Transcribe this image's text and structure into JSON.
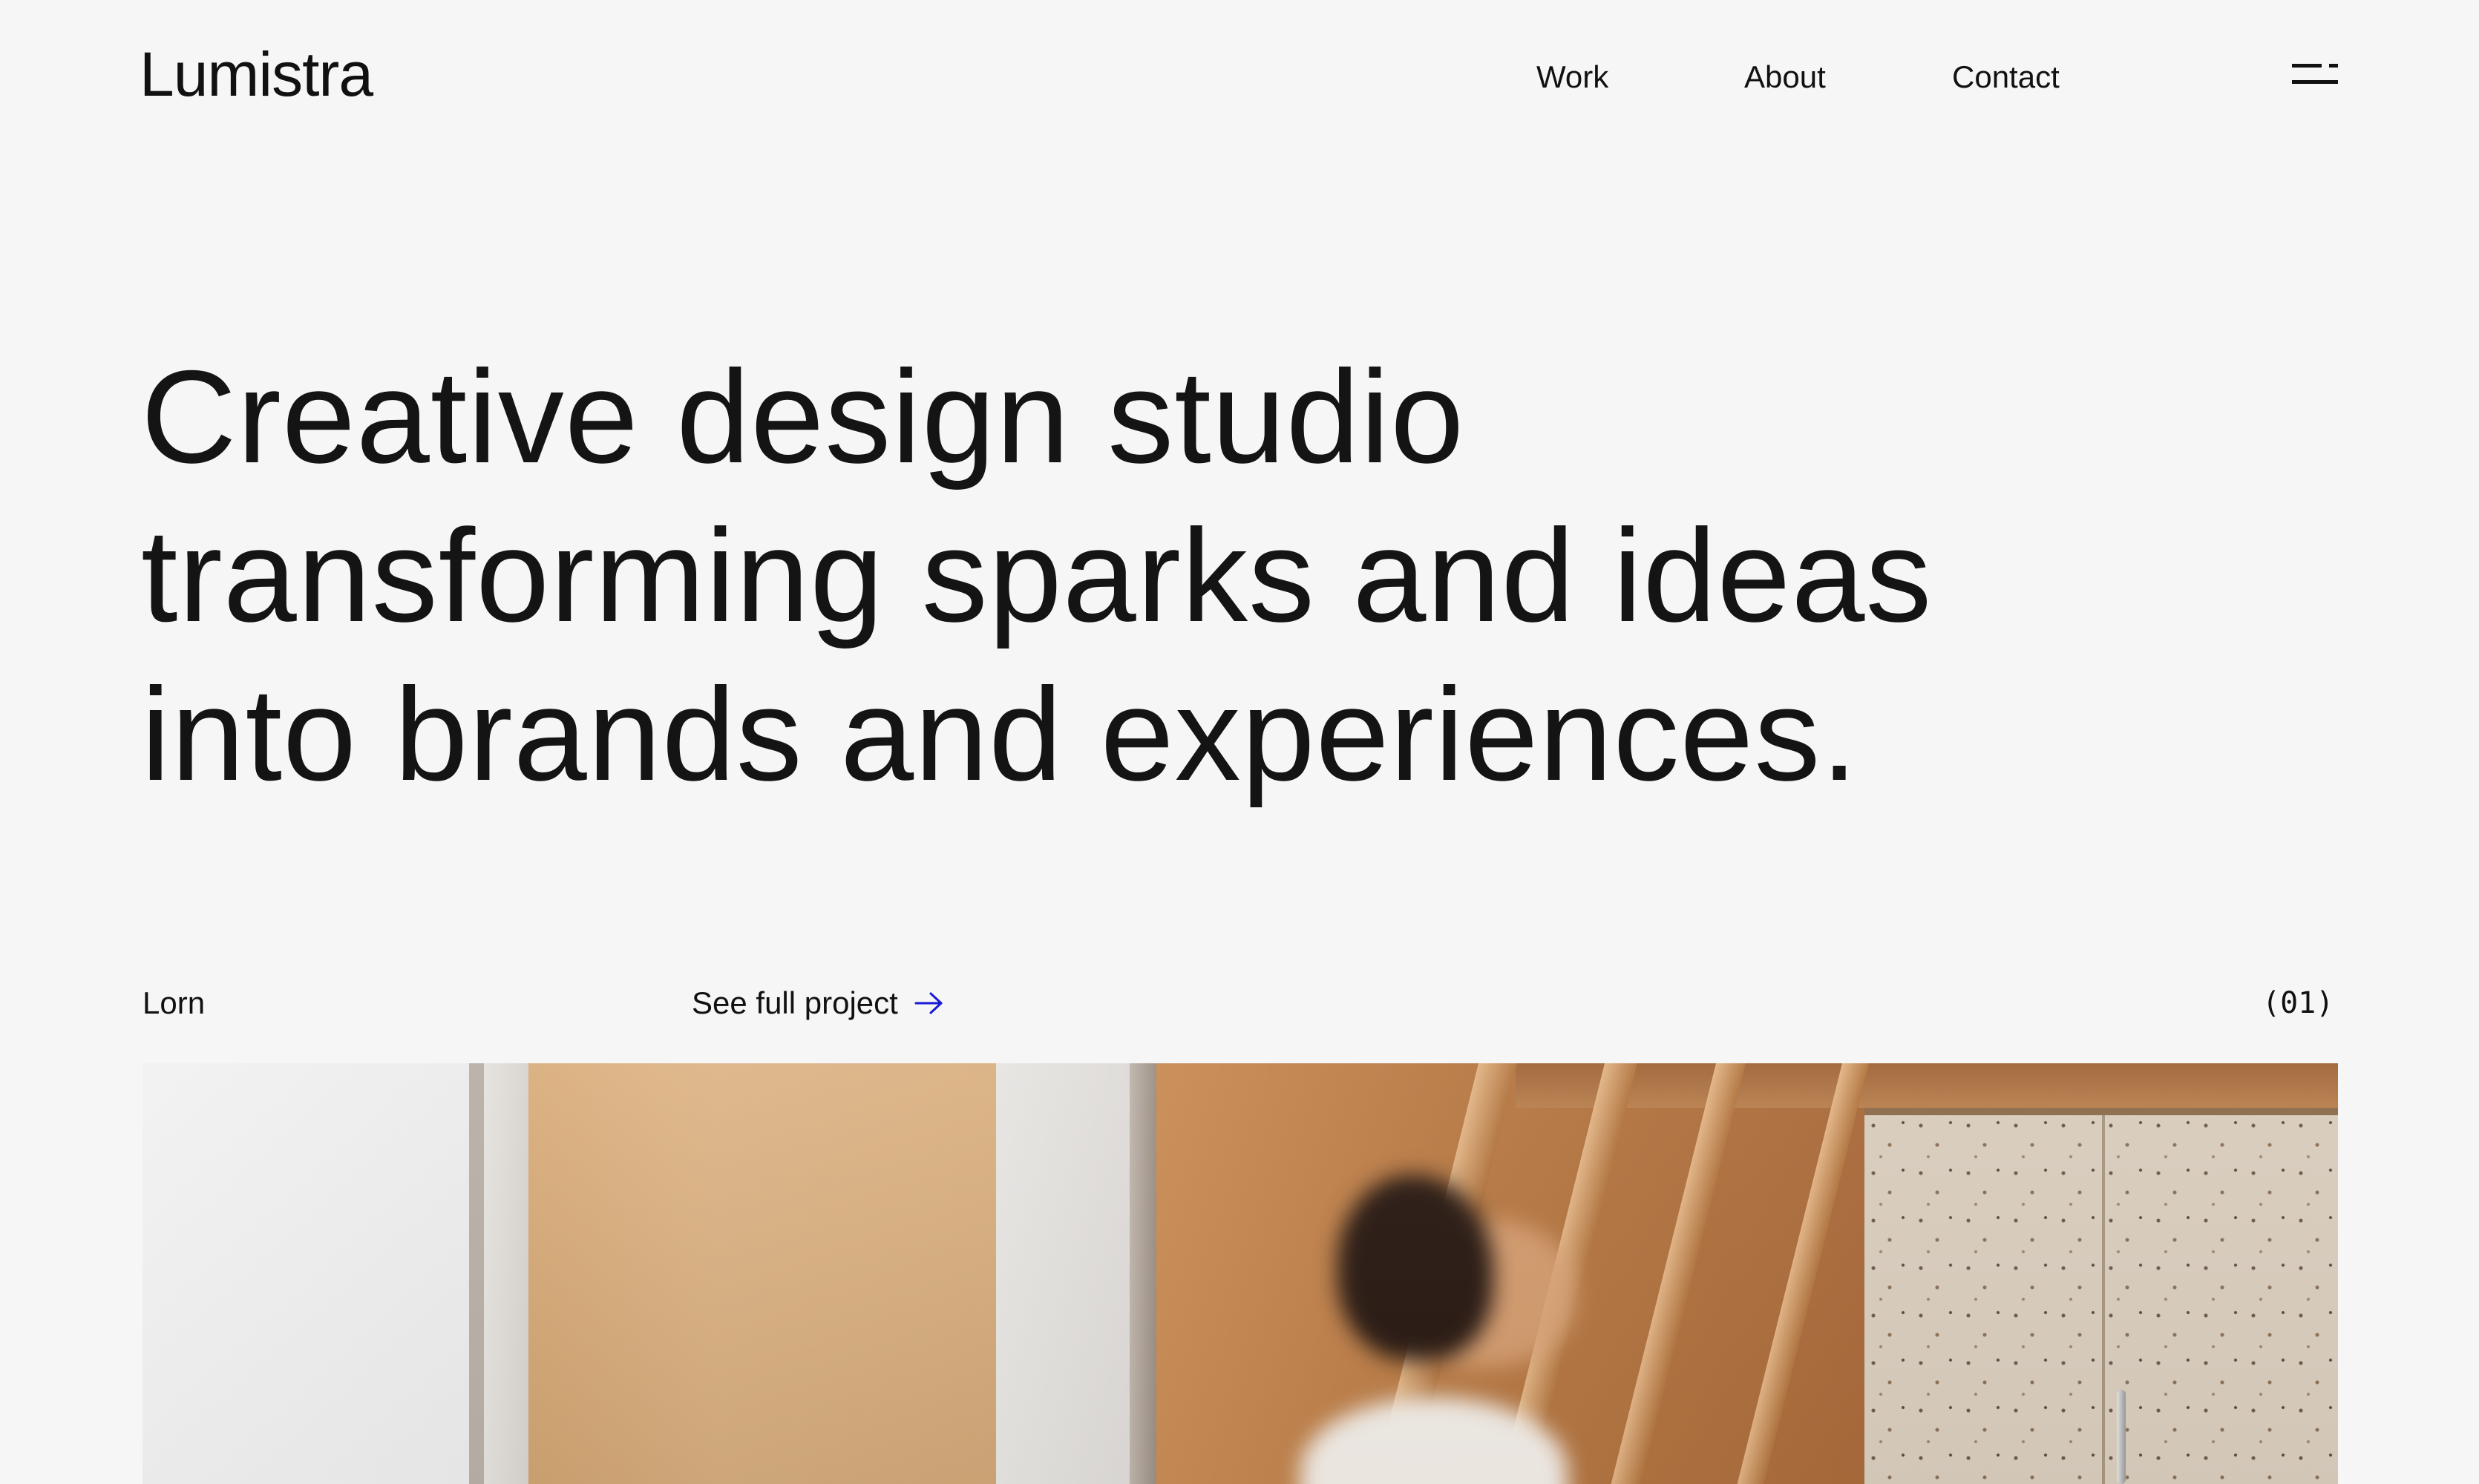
{
  "header": {
    "logo": "Lumistra",
    "nav": [
      {
        "label": "Work"
      },
      {
        "label": "About"
      },
      {
        "label": "Contact"
      }
    ],
    "menu_icon": "menu-icon"
  },
  "hero": {
    "lines": [
      "Creative design studio",
      "transforming sparks and ideas",
      "into brands and experiences."
    ]
  },
  "project": {
    "name": "Lorn",
    "link_label": "See full project",
    "link_icon": "arrow-right-icon",
    "index": "(01)"
  },
  "colors": {
    "background": "#f6f6f6",
    "text": "#141414",
    "accent_arrow": "#1a1ad6"
  }
}
